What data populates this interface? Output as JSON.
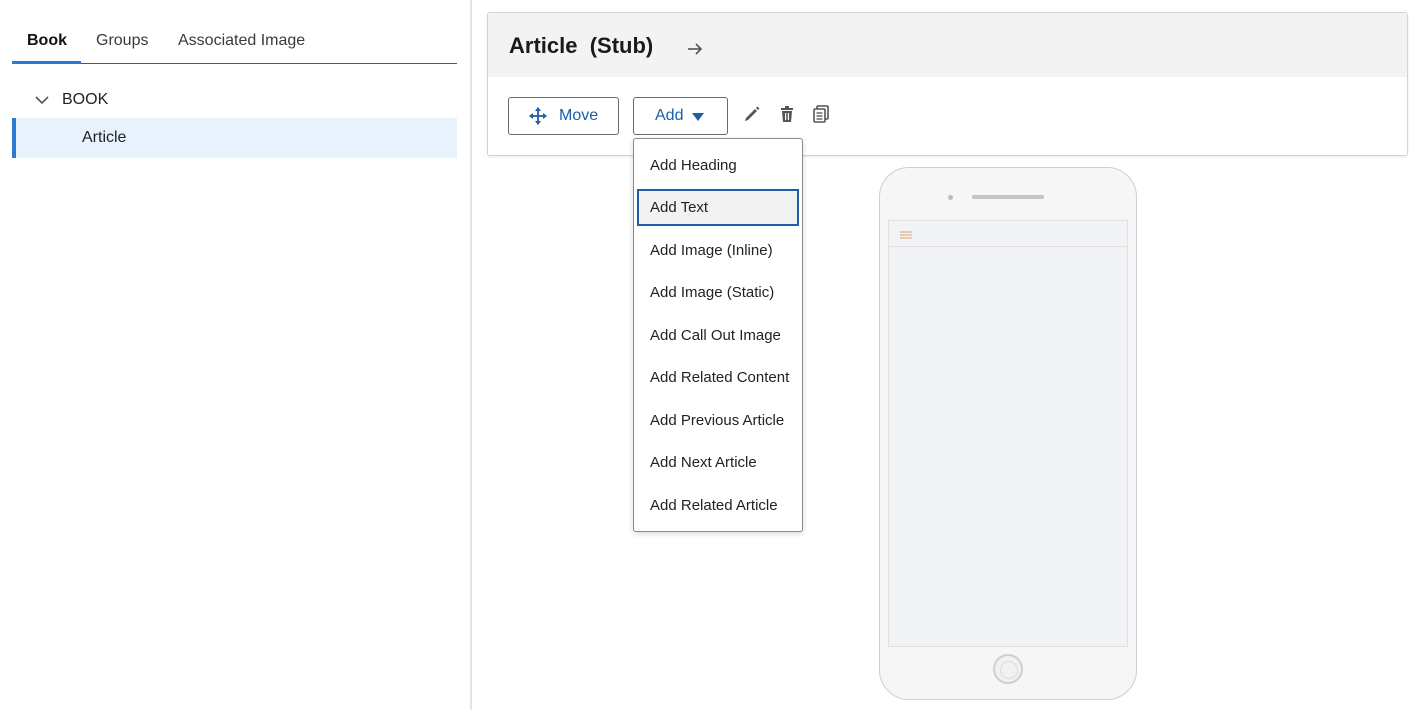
{
  "left_pane": {
    "tabs": [
      {
        "label": "Book",
        "active": true
      },
      {
        "label": "Groups",
        "active": false
      },
      {
        "label": "Associated Image",
        "active": false
      }
    ],
    "tree": {
      "root_label": "BOOK",
      "root_icon": "chevron-down-icon",
      "selected_child": "Article"
    }
  },
  "header": {
    "title": "Article  (Stub)",
    "navigate_icon": "arrow-right-icon"
  },
  "toolbar": {
    "move_label": "Move",
    "move_icon": "move-arrows-icon",
    "add_label": "Add",
    "add_icon": "caret-down-icon",
    "icons": [
      "pencil-icon",
      "trash-icon",
      "copy-icon"
    ]
  },
  "add_menu": {
    "items": [
      "Add Heading",
      "Add Text",
      "Add Image (Inline)",
      "Add Image (Static)",
      "Add Call Out Image",
      "Add Related Content",
      "Add Previous Article",
      "Add Next Article",
      "Add Related Article"
    ],
    "focused": "Add Text"
  },
  "colors": {
    "accent": "#2b7ad1",
    "link_blue": "#1b5fa8",
    "selected_bg": "#e8f2fc",
    "header_bg": "#f3f3f3",
    "phone_menu_icon": "#e0a060"
  }
}
